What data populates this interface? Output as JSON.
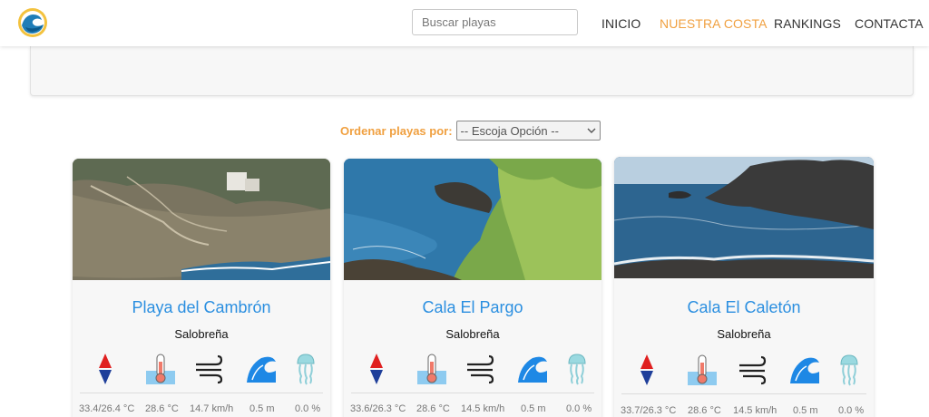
{
  "navbar": {
    "search_placeholder": "Buscar playas",
    "links": [
      {
        "label": "INICIO",
        "active": false
      },
      {
        "label": "NUESTRA COSTA",
        "active": true
      },
      {
        "label": "RANKINGS",
        "active": false
      },
      {
        "label": "CONTACTA",
        "active": false
      }
    ]
  },
  "sort": {
    "label": "Ordenar playas por:",
    "selected": "-- Escoja Opción --"
  },
  "beaches": [
    {
      "name": "Playa del Cambrón",
      "town": "Salobreña",
      "stats": {
        "air_temp": "33.4/26.4 °C",
        "water_temp": "28.6 °C",
        "wind": "14.7 km/h",
        "waves": "0.5 m",
        "jellyfish": "0.0 %"
      }
    },
    {
      "name": "Cala El Pargo",
      "town": "Salobreña",
      "stats": {
        "air_temp": "33.6/26.3 °C",
        "water_temp": "28.6 °C",
        "wind": "14.5 km/h",
        "waves": "0.5 m",
        "jellyfish": "0.0 %"
      }
    },
    {
      "name": "Cala El Caletón",
      "town": "Salobreña",
      "stats": {
        "air_temp": "33.7/26.3 °C",
        "water_temp": "28.6 °C",
        "wind": "14.5 km/h",
        "waves": "0.5 m",
        "jellyfish": "0.0 %"
      }
    }
  ],
  "colors": {
    "accent": "#f0a040",
    "title_blue": "#2b8fe0",
    "wave_blue": "#1e88e5"
  }
}
